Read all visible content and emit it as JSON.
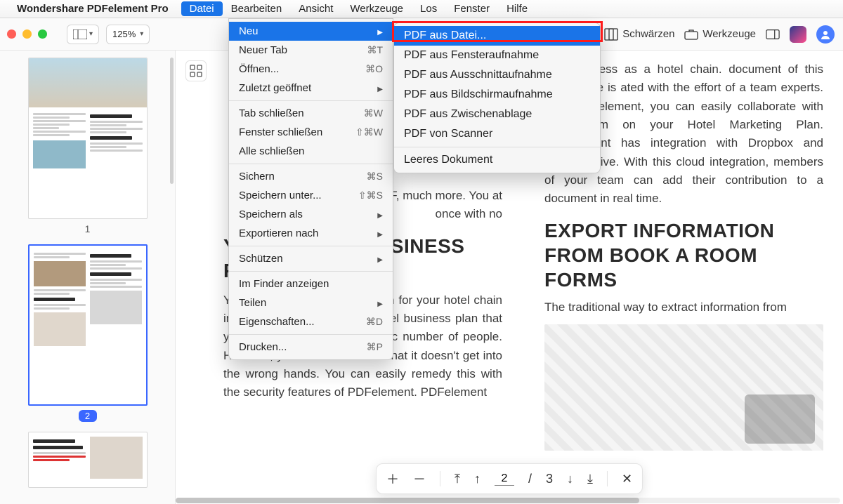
{
  "menubar": {
    "app": "Wondershare PDFelement Pro",
    "items": [
      "Datei",
      "Bearbeiten",
      "Ansicht",
      "Werkzeuge",
      "Los",
      "Fenster",
      "Hilfe"
    ],
    "active": "Datei"
  },
  "toolbar": {
    "zoom": "125%",
    "schwarzen": "Schwärzen",
    "werkzeuge": "Werkzeuge"
  },
  "file_menu": {
    "groups": [
      [
        {
          "label": "Neu",
          "shortcut": "",
          "arrow": true,
          "hl": true
        },
        {
          "label": "Neuer Tab",
          "shortcut": "⌘T"
        },
        {
          "label": "Öffnen...",
          "shortcut": "⌘O"
        },
        {
          "label": "Zuletzt geöffnet",
          "shortcut": "",
          "arrow": true
        }
      ],
      [
        {
          "label": "Tab schließen",
          "shortcut": "⌘W"
        },
        {
          "label": "Fenster schließen",
          "shortcut": "⇧⌘W"
        },
        {
          "label": "Alle schließen",
          "shortcut": ""
        }
      ],
      [
        {
          "label": "Sichern",
          "shortcut": "⌘S"
        },
        {
          "label": "Speichern unter...",
          "shortcut": "⇧⌘S"
        },
        {
          "label": "Speichern als",
          "shortcut": "",
          "arrow": true
        },
        {
          "label": "Exportieren nach",
          "shortcut": "",
          "arrow": true
        }
      ],
      [
        {
          "label": "Schützen",
          "shortcut": "",
          "arrow": true
        }
      ],
      [
        {
          "label": "Im Finder anzeigen",
          "shortcut": ""
        },
        {
          "label": "Teilen",
          "shortcut": "",
          "arrow": true
        },
        {
          "label": "Eigenschaften...",
          "shortcut": "⌘D"
        }
      ],
      [
        {
          "label": "Drucken...",
          "shortcut": "⌘P"
        }
      ]
    ]
  },
  "neu_submenu": {
    "groups": [
      [
        {
          "label": "PDF aus Datei...",
          "hl": true
        },
        {
          "label": "PDF aus Fensteraufnahme"
        },
        {
          "label": "PDF aus Ausschnittaufnahme"
        },
        {
          "label": "PDF aus Bildschirmaufnahme"
        },
        {
          "label": "PDF aus Zwischenablage"
        },
        {
          "label": "PDF von Scanner"
        }
      ],
      [
        {
          "label": "Leeres Dokument"
        }
      ]
    ]
  },
  "thumbs": {
    "p1": "1",
    "p2": "2"
  },
  "doc": {
    "colL_head": "YOUR HOTEL BUSINESS PLAN",
    "colL_p1": "means you can Receipt to PDF, much more. You at once with no",
    "colL_p2": "You want to open a new branch for your hotel chain in another city. You have a hotel business plan that you have shared with a specific number of people. However, you need to be sure that it doesn't get into the wrong hands. You can easily remedy this with the security features of PDFelement. PDFelement",
    "colR_p1": "your success as a hotel chain. document of this importance is ated with the effort of a team experts. With PDFelement, you can easily collaborate with your team on your Hotel Marketing Plan. PDFelement has integration with Dropbox and Google Drive. With this cloud integration, members of your team can add their contribution to a document in real time.",
    "colR_head": "EXPORT INFORMATION FROM BOOK A ROOM FORMS",
    "colR_p2": "The traditional way to extract information from"
  },
  "pagenav": {
    "page": "2",
    "total": "3"
  }
}
